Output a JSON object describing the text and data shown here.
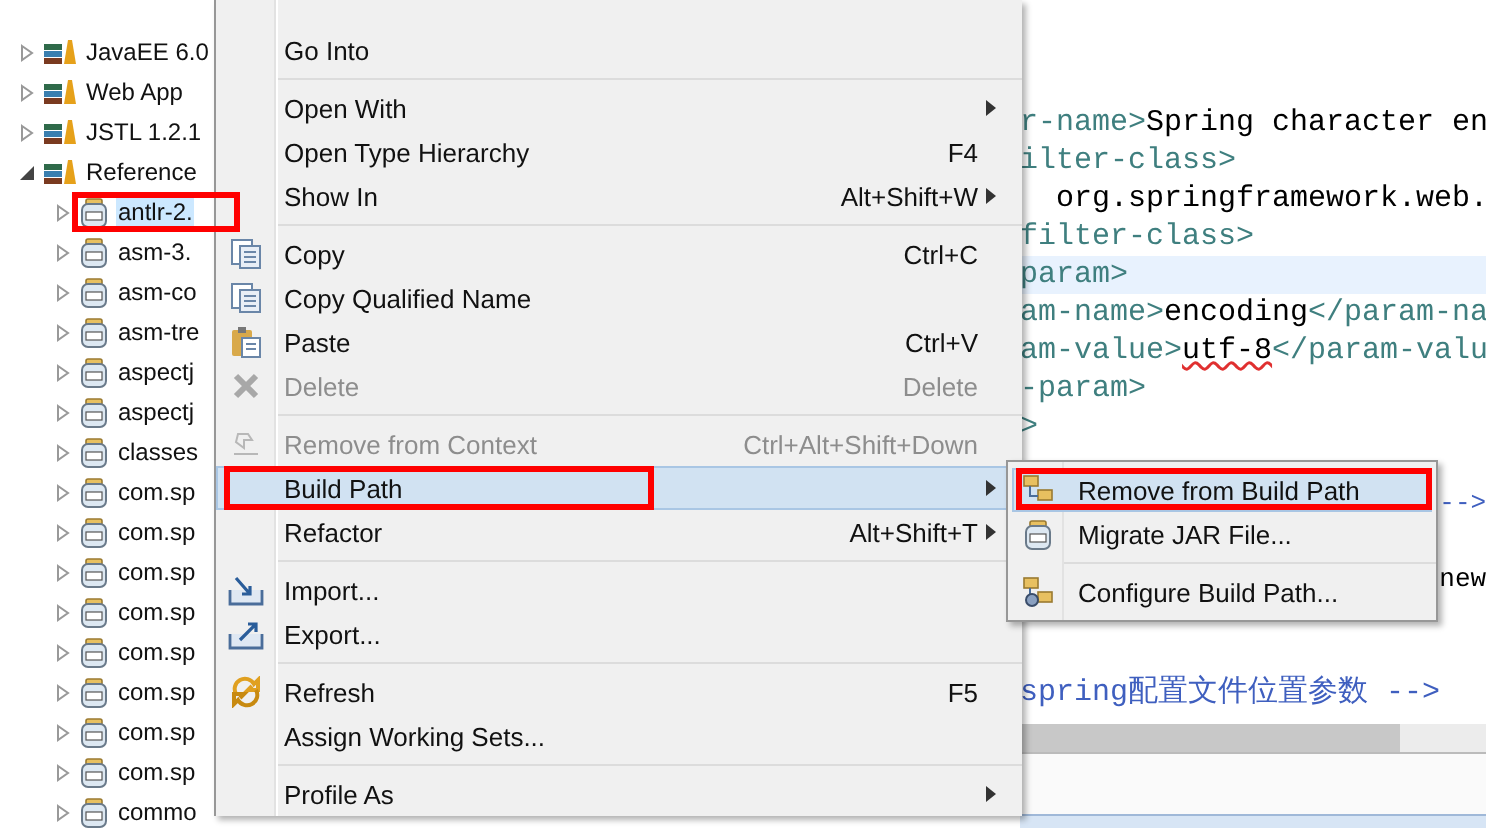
{
  "tree": [
    {
      "label": "JavaEE 6.0",
      "kind": "library",
      "expanded": false,
      "selected": false,
      "outlined": false
    },
    {
      "label": "Web App",
      "kind": "library",
      "expanded": false,
      "selected": false,
      "outlined": false
    },
    {
      "label": "JSTL 1.2.1",
      "kind": "library",
      "expanded": false,
      "selected": false,
      "outlined": false
    },
    {
      "label": "Reference",
      "kind": "library",
      "expanded": true,
      "selected": false,
      "outlined": false,
      "children": [
        {
          "label": "antlr-2.",
          "kind": "jar",
          "expanded": false,
          "selected": true,
          "outlined": true
        },
        {
          "label": "asm-3.",
          "kind": "jar",
          "expanded": false,
          "selected": false,
          "outlined": false
        },
        {
          "label": "asm-co",
          "kind": "jar",
          "expanded": false,
          "selected": false,
          "outlined": false
        },
        {
          "label": "asm-tre",
          "kind": "jar",
          "expanded": false,
          "selected": false,
          "outlined": false
        },
        {
          "label": "aspectj",
          "kind": "jar",
          "expanded": false,
          "selected": false,
          "outlined": false
        },
        {
          "label": "aspectj",
          "kind": "jar",
          "expanded": false,
          "selected": false,
          "outlined": false
        },
        {
          "label": "classes",
          "kind": "jar",
          "expanded": false,
          "selected": false,
          "outlined": false
        },
        {
          "label": "com.sp",
          "kind": "jar",
          "expanded": false,
          "selected": false,
          "outlined": false
        },
        {
          "label": "com.sp",
          "kind": "jar",
          "expanded": false,
          "selected": false,
          "outlined": false
        },
        {
          "label": "com.sp",
          "kind": "jar",
          "expanded": false,
          "selected": false,
          "outlined": false
        },
        {
          "label": "com.sp",
          "kind": "jar",
          "expanded": false,
          "selected": false,
          "outlined": false
        },
        {
          "label": "com.sp",
          "kind": "jar",
          "expanded": false,
          "selected": false,
          "outlined": false
        },
        {
          "label": "com.sp",
          "kind": "jar",
          "expanded": false,
          "selected": false,
          "outlined": false
        },
        {
          "label": "com.sp",
          "kind": "jar",
          "expanded": false,
          "selected": false,
          "outlined": false
        },
        {
          "label": "com.sp",
          "kind": "jar",
          "expanded": false,
          "selected": false,
          "outlined": false
        },
        {
          "label": "commo",
          "kind": "jar",
          "expanded": false,
          "selected": false,
          "outlined": false
        }
      ]
    }
  ],
  "code_lines": [
    {
      "highlighted": false,
      "kind": "line",
      "segments": [
        {
          "text": "r-name>",
          "kind": "tag"
        },
        {
          "text": "Spring character en",
          "kind": "text"
        }
      ]
    },
    {
      "highlighted": false,
      "kind": "line",
      "segments": [
        {
          "text": "ilter-class>",
          "kind": "tag"
        }
      ]
    },
    {
      "highlighted": false,
      "kind": "line",
      "segments": [
        {
          "text": "  org.springframework.web.",
          "kind": "text"
        }
      ]
    },
    {
      "highlighted": false,
      "kind": "line",
      "segments": [
        {
          "text": "filter-class>",
          "kind": "tag"
        }
      ]
    },
    {
      "highlighted": true,
      "kind": "line",
      "segments": [
        {
          "text": "param>",
          "kind": "tag"
        }
      ]
    },
    {
      "highlighted": false,
      "kind": "line",
      "segments": [
        {
          "text": "am-name>",
          "kind": "tag"
        },
        {
          "text": "encoding",
          "kind": "text"
        },
        {
          "text": "</param-na",
          "kind": "tag"
        }
      ]
    },
    {
      "highlighted": false,
      "kind": "line",
      "segments": [
        {
          "text": "am-value>",
          "kind": "tag"
        },
        {
          "text": "utf-8",
          "kind": "misspelled"
        },
        {
          "text": "</param-valu",
          "kind": "tag"
        }
      ]
    },
    {
      "highlighted": false,
      "kind": "line",
      "segments": [
        {
          "text": "-param>",
          "kind": "tag"
        }
      ]
    },
    {
      "highlighted": false,
      "kind": "line",
      "segments": [
        {
          "text": ">",
          "kind": "tag"
        }
      ]
    },
    {
      "highlighted": false,
      "kind": "blank"
    },
    {
      "highlighted": false,
      "kind": "tail",
      "segments": [
        {
          "text": "-->",
          "kind": "comment"
        }
      ]
    },
    {
      "highlighted": false,
      "kind": "blank"
    },
    {
      "highlighted": false,
      "kind": "tail",
      "segments": [
        {
          "text": "new",
          "kind": "text"
        }
      ]
    },
    {
      "highlighted": false,
      "kind": "blank"
    },
    {
      "highlighted": false,
      "kind": "blank"
    },
    {
      "highlighted": false,
      "kind": "line",
      "segments": [
        {
          "text": "spring配置文件位置参数 -->",
          "kind": "comment"
        }
      ]
    }
  ],
  "context_menu": {
    "items": [
      {
        "kind": "plain",
        "label": "Go Into",
        "submenu": false,
        "disabled": false,
        "selected": false,
        "outlined": false
      },
      {
        "kind": "separator"
      },
      {
        "kind": "plain",
        "label": "Open With",
        "submenu": true,
        "disabled": false,
        "selected": false,
        "outlined": false
      },
      {
        "kind": "plain",
        "label": "Open Type Hierarchy",
        "shortcut": "F4",
        "submenu": false,
        "disabled": false,
        "selected": false,
        "outlined": false
      },
      {
        "kind": "plain",
        "label": "Show In",
        "shortcut": "Alt+Shift+W",
        "submenu": true,
        "disabled": false,
        "selected": false,
        "outlined": false
      },
      {
        "kind": "separator"
      },
      {
        "kind": "copy",
        "label": "Copy",
        "shortcut": "Ctrl+C",
        "submenu": false,
        "disabled": false,
        "selected": false,
        "outlined": false
      },
      {
        "kind": "copyname",
        "label": "Copy Qualified Name",
        "submenu": false,
        "disabled": false,
        "selected": false,
        "outlined": false
      },
      {
        "kind": "paste",
        "label": "Paste",
        "shortcut": "Ctrl+V",
        "submenu": false,
        "disabled": false,
        "selected": false,
        "outlined": false
      },
      {
        "kind": "delete",
        "label": "Delete",
        "shortcut": "Delete",
        "submenu": false,
        "disabled": true,
        "selected": false,
        "outlined": false
      },
      {
        "kind": "separator"
      },
      {
        "kind": "context",
        "label": "Remove from Context",
        "shortcut": "Ctrl+Alt+Shift+Down",
        "submenu": false,
        "disabled": true,
        "selected": false,
        "outlined": false
      },
      {
        "kind": "plain",
        "label": "Build Path",
        "submenu": true,
        "disabled": false,
        "selected": true,
        "outlined": true
      },
      {
        "kind": "plain",
        "label": "Refactor",
        "shortcut": "Alt+Shift+T",
        "submenu": true,
        "disabled": false,
        "selected": false,
        "outlined": false
      },
      {
        "kind": "separator"
      },
      {
        "kind": "import",
        "label": "Import...",
        "submenu": false,
        "disabled": false,
        "selected": false,
        "outlined": false
      },
      {
        "kind": "export",
        "label": "Export...",
        "submenu": false,
        "disabled": false,
        "selected": false,
        "outlined": false
      },
      {
        "kind": "separator"
      },
      {
        "kind": "refresh",
        "label": "Refresh",
        "shortcut": "F5",
        "submenu": false,
        "disabled": false,
        "selected": false,
        "outlined": false
      },
      {
        "kind": "plain",
        "label": "Assign Working Sets...",
        "submenu": false,
        "disabled": false,
        "selected": false,
        "outlined": false
      },
      {
        "kind": "separator"
      },
      {
        "kind": "plain",
        "label": "Profile As",
        "submenu": true,
        "disabled": false,
        "selected": false,
        "outlined": false
      }
    ]
  },
  "submenu": {
    "items": [
      {
        "kind": "remove",
        "label": "Remove from Build Path",
        "selected": true,
        "outlined": true
      },
      {
        "kind": "jar",
        "label": "Migrate JAR File...",
        "selected": false,
        "outlined": false
      },
      {
        "kind": "separator"
      },
      {
        "kind": "configure",
        "label": "Configure Build Path...",
        "selected": false,
        "outlined": false
      }
    ]
  }
}
